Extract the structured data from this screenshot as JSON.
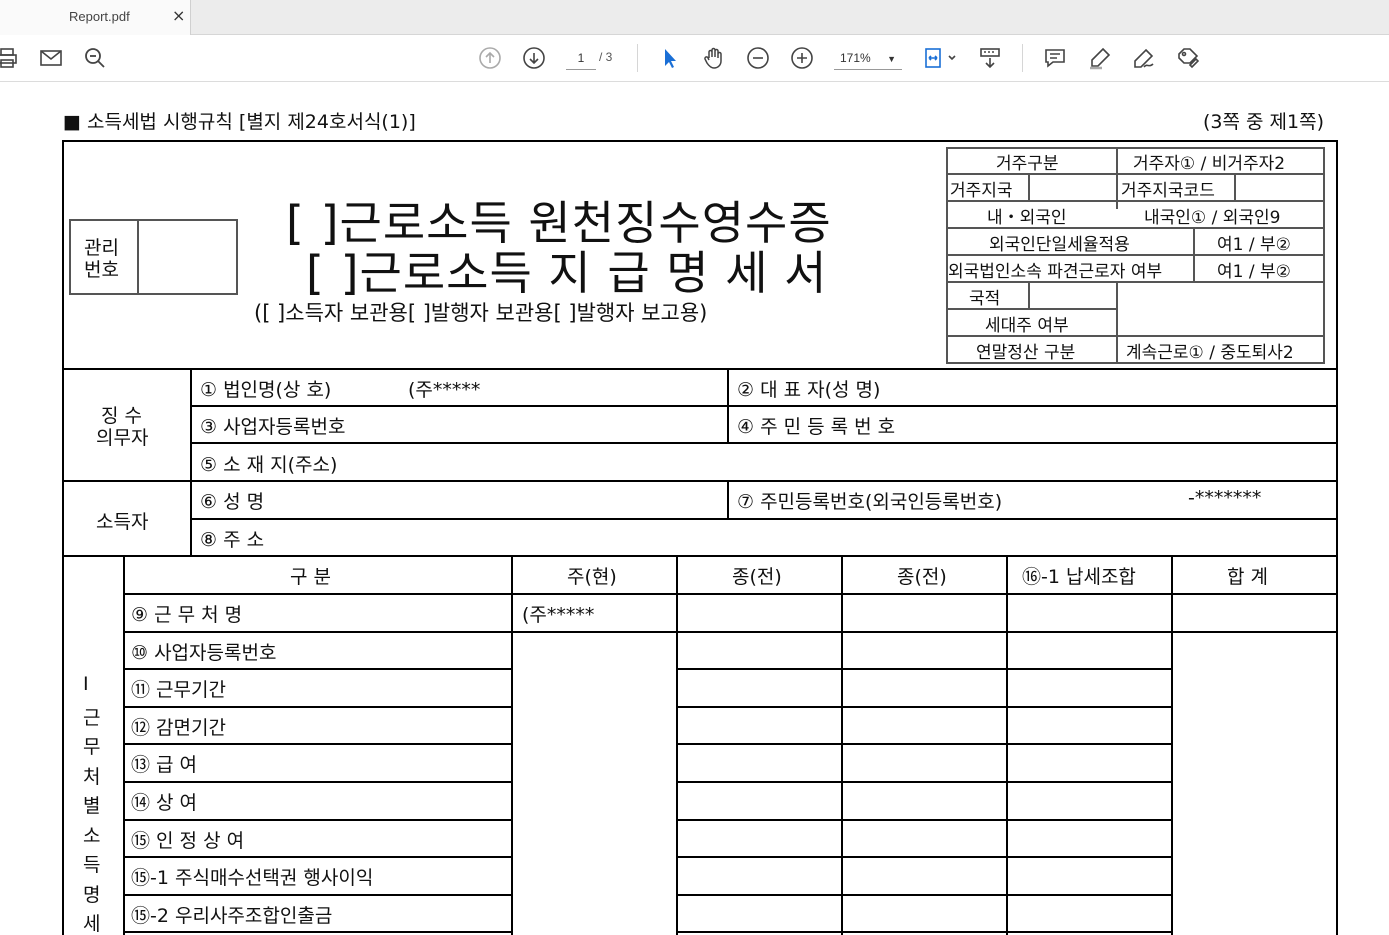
{
  "tab": {
    "title": "Report.pdf",
    "close": "×"
  },
  "toolbar": {
    "page_current": "1",
    "page_total": "/ 3",
    "zoom": "171%",
    "icons": [
      "print-icon",
      "email-icon",
      "search-icon",
      "page-up-icon",
      "page-down-icon",
      "select-cursor-icon",
      "hand-icon",
      "zoom-out-icon",
      "zoom-in-icon",
      "fit-page-icon",
      "scroll-mode-icon",
      "comment-icon",
      "highlight-icon",
      "sign-icon",
      "fill-sign-icon"
    ]
  },
  "form": {
    "header_left": "■ 소득세법 시행규칙 [별지 제24호서식(1)]",
    "header_right": "(3쪽 중 제1쪽)",
    "mgmt_label_1": "관리",
    "mgmt_label_2": "번호",
    "title_1": "[   ]근로소득 원천징수영수증",
    "title_2": "[   ]근로소득 지 급 명 세 서",
    "subtitle": "([      ]소득자 보관용[      ]발행자 보관용[      ]발행자 보고용)",
    "side": {
      "residency_label": "거주구분",
      "residency_value": "거주자① / 비거주자2",
      "region_label": "거주지국",
      "region_code_label": "거주지국코드",
      "nationality_type_label": "내・외국인",
      "nationality_type_value": "내국인① / 외국인9",
      "flat_tax_label": "외국인단일세율적용",
      "flat_tax_value": "여1 / 부②",
      "dispatched_label": "외국법인소속 파견근로자 여부",
      "dispatched_value": "여1 / 부②",
      "country_label": "국적",
      "household_label": "세대주 여부",
      "settlement_label": "연말정산 구분",
      "settlement_value": "계속근로① / 중도퇴사2"
    },
    "payer": {
      "section_1": "징 수",
      "section_2": "의무자",
      "corp_name_label": "① 법인명(상  호)",
      "corp_name_value": "(주*****",
      "rep_label": "② 대 표 자(성   명)",
      "biz_no_label": "③ 사업자등록번호",
      "resident_no_label": "④ 주 민 등 록 번 호",
      "address_label": "⑤ 소 재 지(주소)"
    },
    "earner": {
      "section": "소득자",
      "name_label": "⑥ 성          명",
      "id_label": "⑦ 주민등록번호(외국인등록번호)",
      "id_value": "-*******",
      "address_label": "⑧ 주          소"
    },
    "detail": {
      "vertical_label": [
        "Ⅰ",
        "근",
        "무",
        "처",
        "별",
        "소",
        "득",
        "명",
        "세"
      ],
      "headers": [
        "구  분",
        "주(현)",
        "종(전)",
        "종(전)",
        "⑯-1 납세조합",
        "합  계"
      ],
      "rows": [
        "⑨ 근  무  처  명",
        "⑩ 사업자등록번호",
        "⑪ 근무기간",
        "⑫ 감면기간",
        "⑬ 급          여",
        "⑭ 상          여",
        "⑮ 인  정  상  여",
        "⑮-1 주식매수선택권 행사이익",
        "⑮-2 우리사주조합인출금"
      ],
      "workplace_current": "(주*****"
    }
  }
}
